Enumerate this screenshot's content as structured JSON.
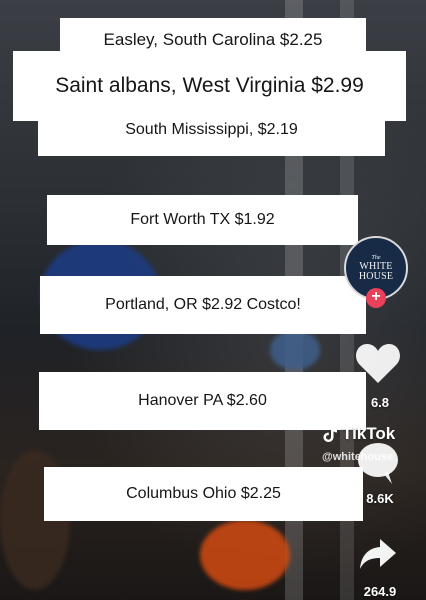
{
  "cards": [
    "Easley, South Carolina $2.25",
    "Saint albans, West Virginia $2.99",
    "South Mississippi, $2.19",
    "Fort Worth TX $1.92",
    "Portland, OR $2.92 Costco!",
    "Hanover PA $2.60",
    "Columbus Ohio $2.25"
  ],
  "account": {
    "avatar_line1": "The",
    "avatar_line2": "WHITE",
    "avatar_line3": "HOUSE",
    "follow": "+"
  },
  "rail": {
    "likes": "6.8",
    "comments": "8.6K",
    "shares": "264.9"
  },
  "watermark": {
    "brand": "TikTok",
    "handle": "@whitehouse"
  },
  "colors": {
    "follow_badge": "#e8415a",
    "avatar_bg": "#172a46"
  }
}
